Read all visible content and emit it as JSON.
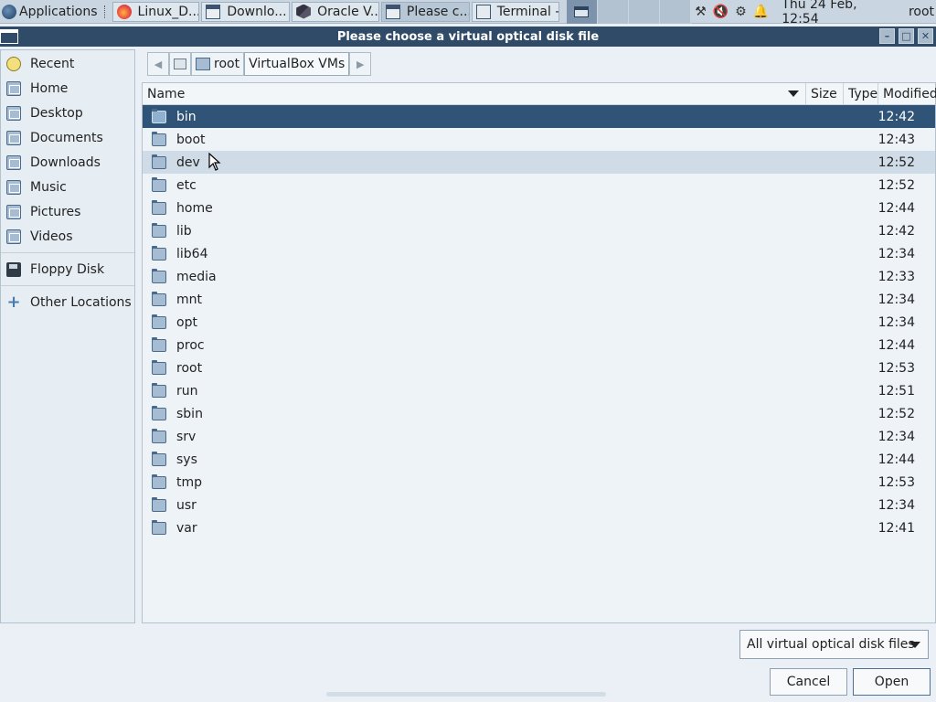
{
  "panel": {
    "applications_label": "Applications",
    "tasks": [
      {
        "label": "Linux_D...",
        "icon": "firefox-icon"
      },
      {
        "label": "Downlo...",
        "icon": "window-icon"
      },
      {
        "label": "Oracle V...",
        "icon": "virtualbox-icon"
      },
      {
        "label": "Please c...",
        "icon": "window-icon"
      },
      {
        "label": "Terminal -",
        "icon": "terminal-icon"
      }
    ],
    "clock": "Thu 24 Feb, 12:54",
    "user": "root"
  },
  "dialog": {
    "title": "Please choose a virtual optical disk file"
  },
  "sidebar": {
    "items": [
      {
        "label": "Recent",
        "icon": "clock-icon"
      },
      {
        "label": "Home",
        "icon": "home-folder-icon"
      },
      {
        "label": "Desktop",
        "icon": "desktop-folder-icon"
      },
      {
        "label": "Documents",
        "icon": "documents-folder-icon"
      },
      {
        "label": "Downloads",
        "icon": "downloads-folder-icon"
      },
      {
        "label": "Music",
        "icon": "music-folder-icon"
      },
      {
        "label": "Pictures",
        "icon": "pictures-folder-icon"
      },
      {
        "label": "Videos",
        "icon": "videos-folder-icon"
      }
    ],
    "devices": [
      {
        "label": "Floppy Disk",
        "icon": "floppy-icon"
      }
    ],
    "other": {
      "label": "Other Locations",
      "icon": "plus-icon"
    }
  },
  "pathbar": {
    "crumbs": [
      "root",
      "VirtualBox VMs"
    ]
  },
  "filelist": {
    "columns": [
      "Name",
      "Size",
      "Type",
      "Modified"
    ],
    "rows": [
      {
        "name": "bin",
        "modified": "12:42"
      },
      {
        "name": "boot",
        "modified": "12:43"
      },
      {
        "name": "dev",
        "modified": "12:52"
      },
      {
        "name": "etc",
        "modified": "12:52"
      },
      {
        "name": "home",
        "modified": "12:44"
      },
      {
        "name": "lib",
        "modified": "12:42"
      },
      {
        "name": "lib64",
        "modified": "12:34"
      },
      {
        "name": "media",
        "modified": "12:33"
      },
      {
        "name": "mnt",
        "modified": "12:34"
      },
      {
        "name": "opt",
        "modified": "12:34"
      },
      {
        "name": "proc",
        "modified": "12:44"
      },
      {
        "name": "root",
        "modified": "12:53"
      },
      {
        "name": "run",
        "modified": "12:51"
      },
      {
        "name": "sbin",
        "modified": "12:52"
      },
      {
        "name": "srv",
        "modified": "12:34"
      },
      {
        "name": "sys",
        "modified": "12:44"
      },
      {
        "name": "tmp",
        "modified": "12:53"
      },
      {
        "name": "usr",
        "modified": "12:34"
      },
      {
        "name": "var",
        "modified": "12:41"
      }
    ],
    "selected_index": 0,
    "hover_index": 2
  },
  "filter": {
    "selected": "All virtual optical disk files"
  },
  "buttons": {
    "cancel": "Cancel",
    "open": "Open"
  }
}
